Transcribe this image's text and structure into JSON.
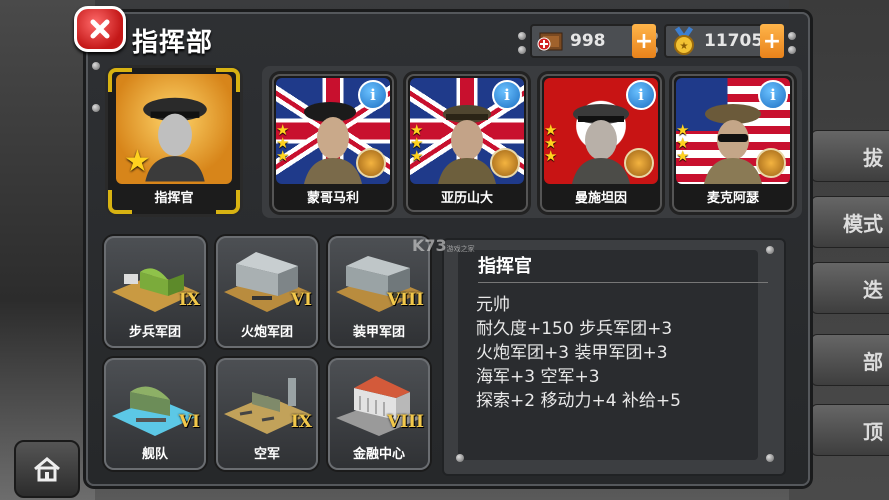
{
  "header": {
    "title": "指挥部"
  },
  "resources": [
    {
      "icon": "supply-crate-icon",
      "value": "998",
      "plus": "+"
    },
    {
      "icon": "gold-medal-icon",
      "value": "11705",
      "plus": "+"
    }
  ],
  "self": {
    "name": "指挥官"
  },
  "commanders": [
    {
      "name": "蒙哥马利",
      "flag": "uk",
      "stars": 3
    },
    {
      "name": "亚历山大",
      "flag": "uk",
      "stars": 3
    },
    {
      "name": "曼施坦因",
      "flag": "de",
      "stars": 3
    },
    {
      "name": "麦克阿瑟",
      "flag": "us",
      "stars": 3
    }
  ],
  "buildings": [
    {
      "name": "步兵军团",
      "level": "IX"
    },
    {
      "name": "火炮军团",
      "level": "VI"
    },
    {
      "name": "装甲军团",
      "level": "VIII"
    },
    {
      "name": "舰队",
      "level": "VI"
    },
    {
      "name": "空军",
      "level": "IX"
    },
    {
      "name": "金融中心",
      "level": "VIII"
    }
  ],
  "info": {
    "title": "指挥官",
    "lines": [
      "元帅",
      "耐久度+150  步兵军团+3",
      "火炮军团+3  装甲军团+3",
      "海军+3  空军+3",
      "探索+2  移动力+4  补给+5"
    ]
  },
  "side_tabs": [
    "拔",
    "模式",
    "迭",
    "部",
    "顶"
  ],
  "watermark": {
    "main": "K73",
    "sub": "游戏之家"
  },
  "colors": {
    "accent_orange": "#e8821b",
    "gold": "#d8b312",
    "close_red": "#c41818",
    "info_blue": "#1d6fc2"
  }
}
